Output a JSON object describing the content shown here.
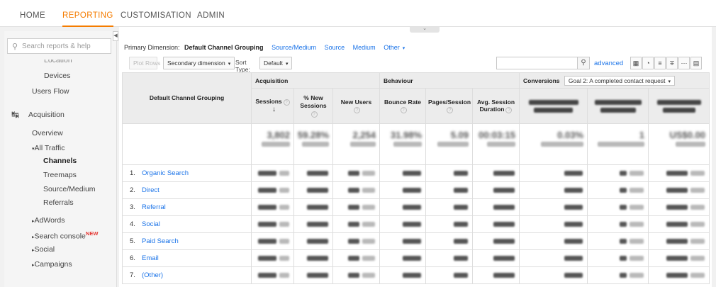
{
  "topnav": {
    "tabs": [
      {
        "label": "HOME",
        "active": false
      },
      {
        "label": "REPORTING",
        "active": true
      },
      {
        "label": "CUSTOMISATION",
        "active": false
      },
      {
        "label": "ADMIN",
        "active": false
      }
    ]
  },
  "sidebar": {
    "search_placeholder": "Search reports & help",
    "items": {
      "location": "Location",
      "devices": "Devices",
      "users_flow": "Users Flow",
      "acquisition": "Acquisition",
      "overview": "Overview",
      "all_traffic": "All Traffic",
      "channels": "Channels",
      "treemaps": "Treemaps",
      "source_medium": "Source/Medium",
      "referrals": "Referrals",
      "adwords": "AdWords",
      "search_console": "Search console",
      "search_console_badge": "NEW",
      "social": "Social",
      "campaigns": "Campaigns"
    }
  },
  "dimension": {
    "label": "Primary Dimension:",
    "current": "Default Channel Grouping",
    "links": [
      "Source/Medium",
      "Source",
      "Medium",
      "Other"
    ]
  },
  "toolbar": {
    "plot_rows": "Plot Rows",
    "secondary_dimension": "Secondary dimension",
    "sort_type_label": "Sort Type:",
    "sort_type_value": "Default",
    "advanced": "advanced"
  },
  "table": {
    "first_col_header": "Default Channel Grouping",
    "groups": {
      "acquisition": "Acquisition",
      "behaviour": "Behaviour",
      "conversions": "Conversions",
      "goal_select": "Goal 2: A completed contact request"
    },
    "columns": {
      "sessions": "Sessions",
      "pct_new_sessions": "% New Sessions",
      "new_users": "New Users",
      "bounce_rate": "Bounce Rate",
      "pages_session": "Pages/Session",
      "avg_session_duration": "Avg. Session Duration"
    },
    "totals": {
      "sessions": "3,802",
      "pct_new_sessions": "59.28%",
      "new_users": "2,254",
      "bounce_rate": "31.98%",
      "pages_session": "5.09",
      "avg_session_duration": "00:03:15",
      "conv_rate": "0.03%",
      "completions": "1",
      "value": "US$0.00"
    },
    "rows": [
      {
        "num": "1.",
        "name": "Organic Search"
      },
      {
        "num": "2.",
        "name": "Direct"
      },
      {
        "num": "3.",
        "name": "Referral"
      },
      {
        "num": "4.",
        "name": "Social"
      },
      {
        "num": "5.",
        "name": "Paid Search"
      },
      {
        "num": "6.",
        "name": "Email"
      },
      {
        "num": "7.",
        "name": "(Other)"
      }
    ]
  }
}
